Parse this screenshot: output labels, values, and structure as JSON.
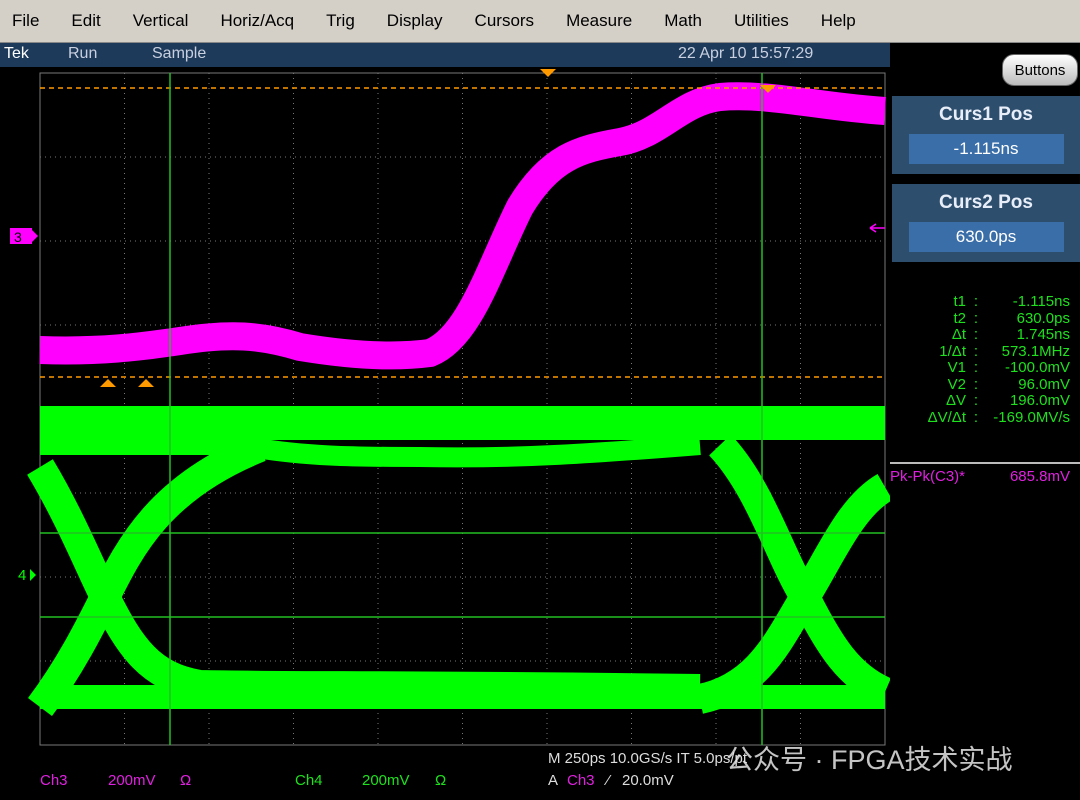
{
  "menu": [
    "File",
    "Edit",
    "Vertical",
    "Horiz/Acq",
    "Trig",
    "Display",
    "Cursors",
    "Measure",
    "Math",
    "Utilities",
    "Help"
  ],
  "status": {
    "brand": "Tek",
    "state": "Run",
    "mode": "Sample",
    "datetime": "22 Apr 10 15:57:29"
  },
  "buttons_label": "Buttons",
  "curs1": {
    "title": "Curs1 Pos",
    "value": "-1.115ns"
  },
  "curs2": {
    "title": "Curs2 Pos",
    "value": "630.0ps"
  },
  "readout": [
    {
      "label": "t1",
      "value": "-1.115ns"
    },
    {
      "label": "t2",
      "value": "630.0ps"
    },
    {
      "label": "Δt",
      "value": "1.745ns"
    },
    {
      "label": "1/Δt",
      "value": "573.1MHz"
    },
    {
      "label": "V1",
      "value": "-100.0mV"
    },
    {
      "label": "V2",
      "value": "96.0mV"
    },
    {
      "label": "ΔV",
      "value": "196.0mV"
    },
    {
      "label": "ΔV/Δt",
      "value": "-169.0MV/s"
    }
  ],
  "measurement": {
    "label": "Pk-Pk(C3)*",
    "value": "685.8mV"
  },
  "markers": {
    "ch3": "3",
    "ch4": "4"
  },
  "bottom": {
    "ch3": {
      "name": "Ch3",
      "scale": "200mV",
      "coupling": "Ω"
    },
    "ch4": {
      "name": "Ch4",
      "scale": "200mV",
      "coupling": "Ω"
    },
    "horiz": "M 250ps 10.0GS/s  IT 5.0ps/pt",
    "trig_prefix": "A",
    "trig_src": "Ch3",
    "trig_slope": "⁄",
    "trig_level": "20.0mV"
  },
  "watermark": "公众号 · FPGA技术实战",
  "colors": {
    "ch3": "#ff00ff",
    "ch4": "#00ff00",
    "cursor": "#ff9900",
    "grid": "#808080"
  }
}
